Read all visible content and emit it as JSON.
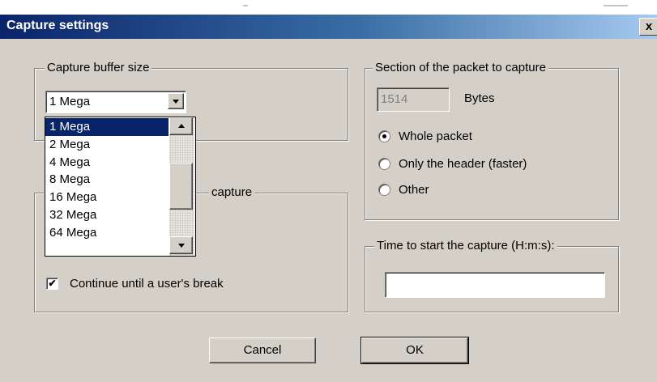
{
  "dialog": {
    "title": "Capture settings",
    "close_label": "x"
  },
  "buffer": {
    "legend": "Capture buffer size",
    "selected": "1 Mega",
    "options": [
      "1 Mega",
      "2 Mega",
      "4 Mega",
      "8 Mega",
      "16 Mega",
      "32 Mega",
      "64 Mega"
    ]
  },
  "stop": {
    "legend_visible": "capture",
    "continue_label": "Continue until a user's break",
    "continue_checked": true
  },
  "section": {
    "legend": "Section of the packet to capture",
    "bytes_value": "1514",
    "bytes_unit": "Bytes",
    "options": [
      {
        "label": "Whole packet",
        "checked": true
      },
      {
        "label": "Only the header (faster)",
        "checked": false
      },
      {
        "label": "Other",
        "checked": false
      }
    ]
  },
  "start_time": {
    "legend": "Time to start the capture (H:m:s):",
    "value": ""
  },
  "buttons": {
    "cancel": "Cancel",
    "ok": "OK"
  },
  "colors": {
    "title_bar_start": "#0a246a",
    "title_bar_end": "#a6caf0",
    "dialog_face": "#d4d0c8",
    "selection": "#0a246a"
  }
}
